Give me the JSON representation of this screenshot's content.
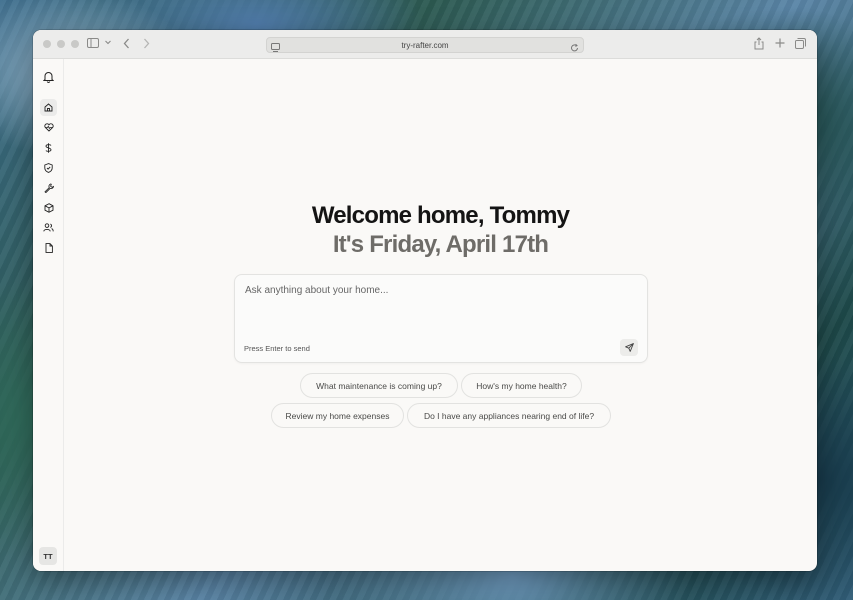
{
  "browser": {
    "url": "try-rafter.com",
    "icons": {
      "sidebar_toggle": "sidebar-icon",
      "back": "chevron-left-icon",
      "forward": "chevron-right-icon",
      "reader": "reader-icon",
      "reload": "reload-icon",
      "share": "share-icon",
      "new_tab": "plus-icon",
      "tabs": "tabs-overview-icon"
    }
  },
  "sidebar": {
    "top_icon": "bell-icon",
    "items": [
      {
        "id": "home",
        "icon": "home-icon",
        "active": true
      },
      {
        "id": "health",
        "icon": "heart-pulse-icon",
        "active": false
      },
      {
        "id": "expenses",
        "icon": "dollar-icon",
        "active": false
      },
      {
        "id": "insurance",
        "icon": "shield-icon",
        "active": false
      },
      {
        "id": "maintenance",
        "icon": "wrench-icon",
        "active": false
      },
      {
        "id": "appliances",
        "icon": "box-icon",
        "active": false
      },
      {
        "id": "people",
        "icon": "users-icon",
        "active": false
      },
      {
        "id": "documents",
        "icon": "file-icon",
        "active": false
      }
    ],
    "avatar_initials": "TT"
  },
  "main": {
    "greeting": "Welcome home, Tommy",
    "date_line": "It's Friday, April 17th",
    "chat": {
      "placeholder": "Ask anything about your home...",
      "hint": "Press Enter to send",
      "send_icon": "send-icon"
    },
    "suggestions": [
      "What maintenance is coming up?",
      "How's my home health?",
      "Review my home expenses",
      "Do I have any appliances nearing end of life?"
    ]
  },
  "colors": {
    "accent_text": "#141414",
    "muted_heading": "#6e6c68",
    "page_background": "#faf9f7"
  }
}
